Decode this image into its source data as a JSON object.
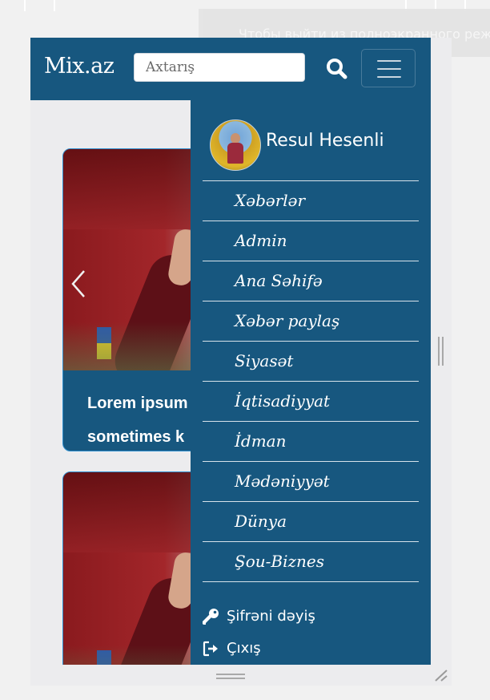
{
  "toast": {
    "text": "Чтобы выйти из полноэкранного режима"
  },
  "navbar": {
    "brand": "Mix.az",
    "search_placeholder": "Axtarış"
  },
  "cards": [
    {
      "title_line1": "Lorem ipsum",
      "title_line2": "sometimes k"
    },
    {
      "title_line1": "",
      "title_line2": ""
    }
  ],
  "sidebar": {
    "user_name": "Resul Hesenli",
    "menu": [
      "Xəbərlər",
      "Admin",
      "Ana Səhifə",
      "Xəbər paylaş",
      "Siyasət",
      "İqtisadiyyat",
      "İdman",
      "Mədəniyyət",
      "Dünya",
      "Şou-Biznes"
    ],
    "change_password": "Şifrəni dəyiş",
    "logout": "Çıxış"
  },
  "colors": {
    "navbar": "#17577f",
    "sidebar": "#17577f",
    "card_border": "#2f8fcf",
    "page_bg": "#ececee"
  },
  "icons": [
    "search-icon",
    "hamburger-icon",
    "chevron-left-icon",
    "key-icon",
    "sign-out-icon"
  ]
}
